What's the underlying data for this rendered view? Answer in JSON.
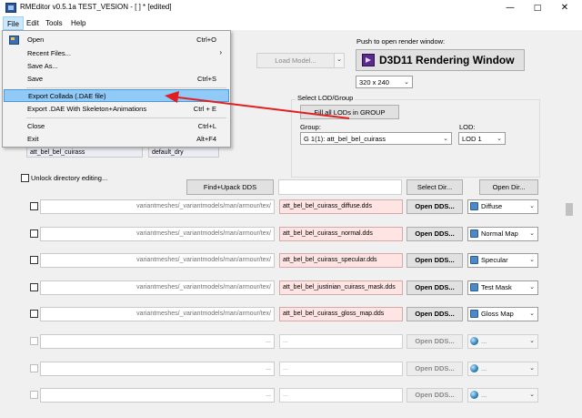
{
  "window": {
    "title": "RMEditor  v0.5.1a TEST_VESION - [ ] * [edited]"
  },
  "menubar": [
    "File",
    "Edit",
    "Tools",
    "Help"
  ],
  "file_menu": [
    {
      "label": "Open",
      "shortcut": "Ctrl+O"
    },
    {
      "label": "Recent Files...",
      "shortcut": "",
      "submenu": true
    },
    {
      "label": "Save As...",
      "shortcut": ""
    },
    {
      "label": "Save",
      "shortcut": "Ctrl+S"
    },
    {
      "label": "Export Collada (.DAE file)",
      "shortcut": ""
    },
    {
      "label": "Export .DAE With Skeleton+Animations",
      "shortcut": "Ctrl + E"
    },
    {
      "label": "Close",
      "shortcut": "Ctrl+L"
    },
    {
      "label": "Exit",
      "shortcut": "Alt+F4"
    }
  ],
  "top": {
    "load_model": "Load Model...",
    "push_label": "Push to open render window:",
    "render_button": "D3D11 Rendering Window",
    "resolution": "320 x 240"
  },
  "lod": {
    "title": "Select LOD/Group",
    "fill_button": "Fill all LODs in GROUP",
    "group_label": "Group:",
    "group_value": "G 1(1): att_bel_bel_cuirass",
    "lod_label": "LOD:",
    "lod_value": "LOD 1"
  },
  "model_fields": {
    "name": "att_bel_bel_cuirass",
    "shader": "default_dry"
  },
  "controls": {
    "unlock_label": "Unlock directory editing...",
    "find_unpack": "Find+Upack DDS",
    "select_dir": "Select Dir...",
    "open_dir": "Open Dir..."
  },
  "textures": [
    {
      "path": "variantmeshes/_variantmodels/man/armour/tex/",
      "file": "att_bel_bel_cuirass_diffuse.dds",
      "button": "Open DDS...",
      "type": "Diffuse",
      "enabled": true
    },
    {
      "path": "variantmeshes/_variantmodels/man/armour/tex/",
      "file": "att_bel_bel_cuirass_normal.dds",
      "button": "Open DDS...",
      "type": "Normal Map",
      "enabled": true
    },
    {
      "path": "variantmeshes/_variantmodels/man/armour/tex/",
      "file": "att_bel_bel_cuirass_specular.dds",
      "button": "Open DDS...",
      "type": "Specular",
      "enabled": true
    },
    {
      "path": "variantmeshes/_variantmodels/man/armour/tex/",
      "file": "att_bel_bel_justinian_cuirass_mask.dds",
      "button": "Open DDS...",
      "type": "Test Mask",
      "enabled": true
    },
    {
      "path": "variantmeshes/_variantmodels/man/armour/tex/",
      "file": "att_bel_bel_cuirass_gloss_map.dds",
      "button": "Open DDS...",
      "type": "Gloss Map",
      "enabled": true
    },
    {
      "path": "...",
      "file": "...",
      "button": "Open DDS...",
      "type": "...",
      "enabled": false
    },
    {
      "path": "...",
      "file": "...",
      "button": "Open DDS...",
      "type": "...",
      "enabled": false
    },
    {
      "path": "...",
      "file": "...",
      "button": "Open DDS...",
      "type": "...",
      "enabled": false
    }
  ],
  "colors": {
    "highlight": "#91c9f7",
    "arrow": "#e02020",
    "texture_field": "#ffe4e4"
  }
}
